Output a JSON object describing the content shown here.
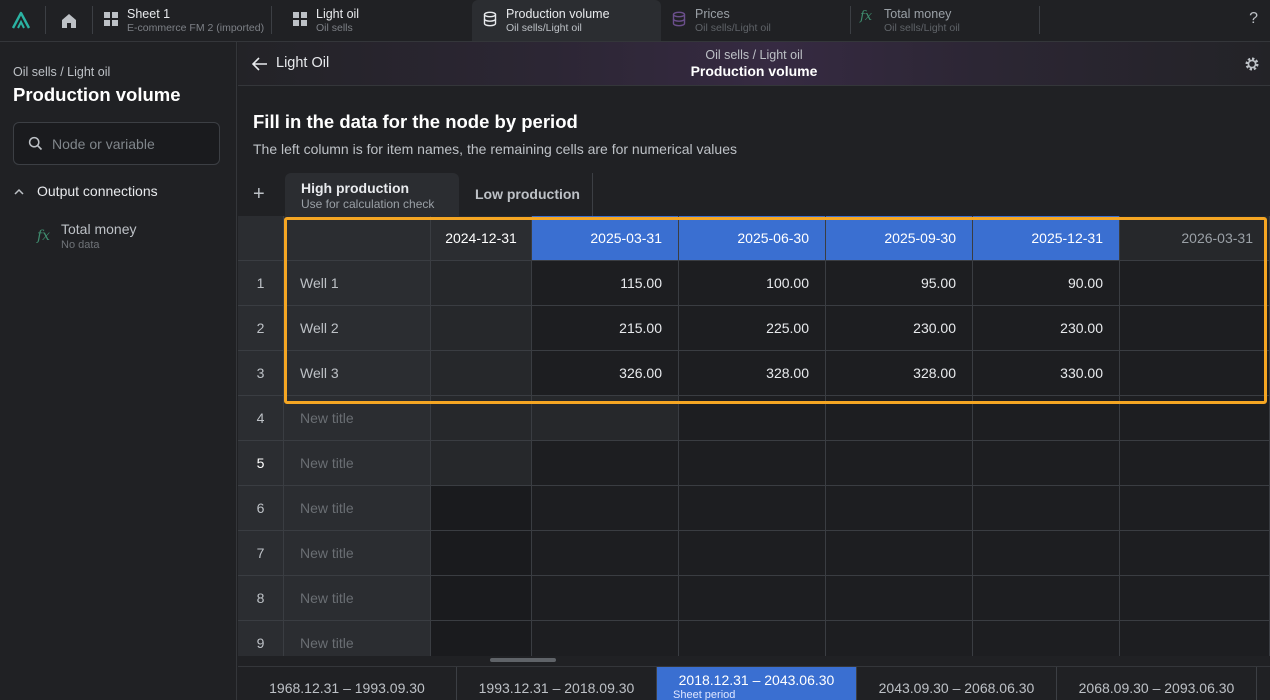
{
  "topbar": {
    "tabs": [
      {
        "title": "Sheet 1",
        "subtitle": "E-commerce FM 2 (imported)",
        "icon": "grid-icon"
      },
      {
        "title": "Light oil",
        "subtitle": "Oil sells",
        "icon": "grid-icon"
      },
      {
        "title": "Production volume",
        "subtitle": "Oil sells/Light oil",
        "icon": "database-icon"
      },
      {
        "title": "Prices",
        "subtitle": "Oil sells/Light oil",
        "icon": "database-icon"
      },
      {
        "title": "Total money",
        "subtitle": "Oil sells/Light oil",
        "icon": "fx-icon"
      }
    ],
    "help": "?"
  },
  "sidebar": {
    "breadcrumb": "Oil sells / Light oil",
    "title": "Production volume",
    "search_placeholder": "Node or variable",
    "section_label": "Output connections",
    "node": {
      "icon": "fx",
      "name": "Total money",
      "status": "No data"
    }
  },
  "header": {
    "back_label": "Light Oil",
    "breadcrumb": "Oil sells / Light oil",
    "title": "Production volume"
  },
  "main": {
    "heading": "Fill in the data for the node by period",
    "subheading": "The left column is for item names, the remaining cells are for numerical values",
    "add": "+",
    "scenario_tabs": [
      {
        "label": "High production",
        "sub": "Use for calculation check"
      },
      {
        "label": "Low production"
      }
    ]
  },
  "table": {
    "columns": [
      "2024-12-31",
      "2025-03-31",
      "2025-06-30",
      "2025-09-30",
      "2025-12-31",
      "2026-03-31"
    ],
    "rows": [
      {
        "num": "1",
        "title": "Well 1",
        "values": [
          "",
          "115.00",
          "100.00",
          "95.00",
          "90.00",
          ""
        ]
      },
      {
        "num": "2",
        "title": "Well 2",
        "values": [
          "",
          "215.00",
          "225.00",
          "230.00",
          "230.00",
          ""
        ]
      },
      {
        "num": "3",
        "title": "Well 3",
        "values": [
          "",
          "326.00",
          "328.00",
          "328.00",
          "330.00",
          ""
        ]
      },
      {
        "num": "4",
        "title": "New title",
        "values": [
          "",
          "",
          "",
          "",
          "",
          ""
        ]
      },
      {
        "num": "5",
        "title": "New title",
        "values": [
          "",
          "",
          "",
          "",
          "",
          ""
        ]
      },
      {
        "num": "6",
        "title": "New title",
        "values": [
          "",
          "",
          "",
          "",
          "",
          ""
        ]
      },
      {
        "num": "7",
        "title": "New title",
        "values": [
          "",
          "",
          "",
          "",
          "",
          ""
        ]
      },
      {
        "num": "8",
        "title": "New title",
        "values": [
          "",
          "",
          "",
          "",
          "",
          ""
        ]
      },
      {
        "num": "9",
        "title": "New title",
        "values": [
          "",
          "",
          "",
          "",
          "",
          ""
        ]
      }
    ]
  },
  "periods": [
    {
      "label": "1968.12.31 – 1993.09.30"
    },
    {
      "label": "1993.12.31 – 2018.09.30"
    },
    {
      "label": "2018.12.31 – 2043.06.30",
      "sub": "Sheet period",
      "active": true
    },
    {
      "label": "2043.09.30 – 2068.06.30"
    },
    {
      "label": "2068.09.30 – 2093.06.30"
    }
  ],
  "colors": {
    "accent": "#3a6fd1",
    "highlight": "#f5a623",
    "logo": "#2bb3a3"
  }
}
